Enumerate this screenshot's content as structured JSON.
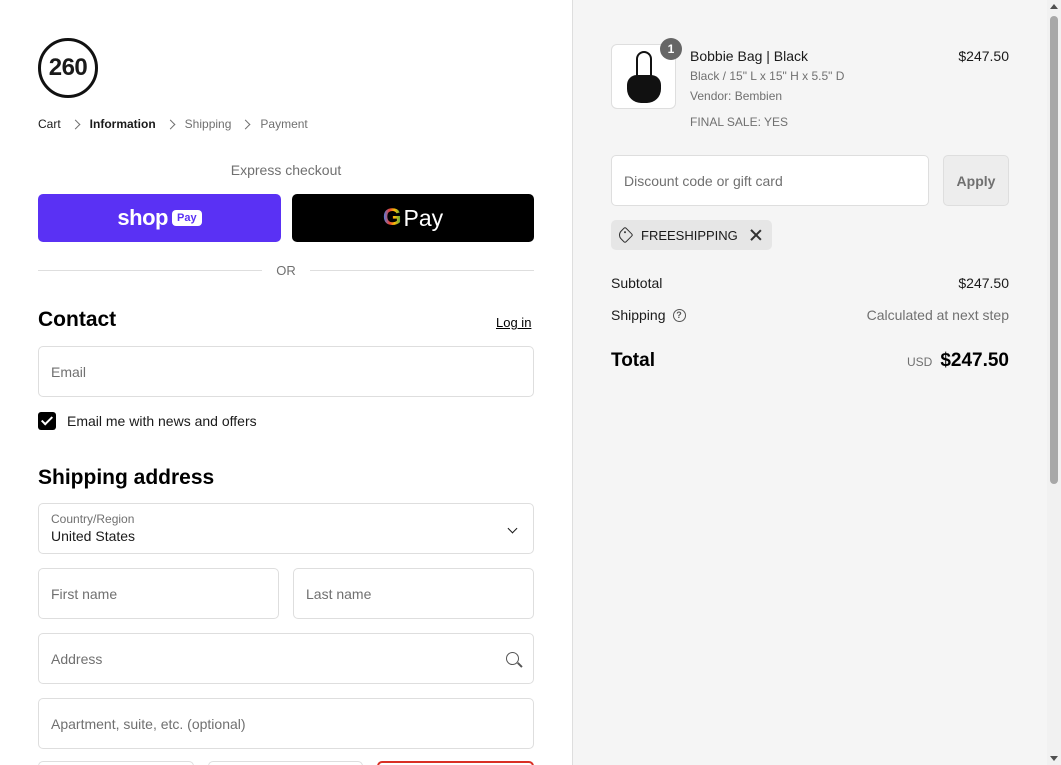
{
  "logo": {
    "text": "260"
  },
  "breadcrumb": [
    {
      "label": "Cart",
      "state": "link"
    },
    {
      "label": "Information",
      "state": "current"
    },
    {
      "label": "Shipping",
      "state": "upcoming"
    },
    {
      "label": "Payment",
      "state": "upcoming"
    }
  ],
  "express": {
    "title": "Express checkout",
    "shop_pay": {
      "word": "shop",
      "pill": "Pay",
      "color": "#5a31f4"
    },
    "google_pay": {
      "g": "G",
      "word": "Pay"
    },
    "or": "OR"
  },
  "contact": {
    "title": "Contact",
    "login": "Log in",
    "email_placeholder": "Email",
    "newsletter_label": "Email me with news and offers",
    "newsletter_checked": true
  },
  "shipping": {
    "title": "Shipping address",
    "country_label": "Country/Region",
    "country_value": "United States",
    "first_name_placeholder": "First name",
    "last_name_placeholder": "Last name",
    "address_placeholder": "Address",
    "apartment_placeholder": "Apartment, suite, etc. (optional)"
  },
  "summary": {
    "product": {
      "quantity": "1",
      "name": "Bobbie Bag | Black",
      "variant": "Black / 15\" L x 15\" H x 5.5\" D",
      "vendor": "Vendor: Bembien",
      "final_sale": "FINAL SALE: YES",
      "price": "$247.50"
    },
    "discount_placeholder": "Discount code or gift card",
    "apply_label": "Apply",
    "applied_code": "FREESHIPPING",
    "subtotal_label": "Subtotal",
    "subtotal_value": "$247.50",
    "shipping_label": "Shipping",
    "shipping_value": "Calculated at next step",
    "total_label": "Total",
    "total_currency": "USD",
    "total_value": "$247.50"
  }
}
